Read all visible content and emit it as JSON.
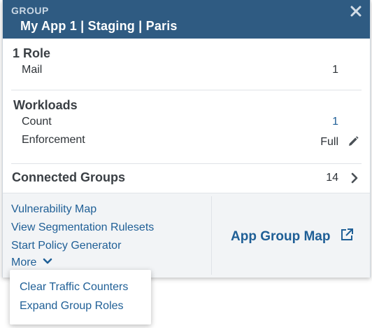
{
  "header": {
    "kicker": "GROUP",
    "title": "My App 1 | Staging | Paris",
    "close_icon": "close-icon"
  },
  "roles": {
    "title": "1 Role",
    "items": [
      {
        "label": "Mail",
        "value": "1"
      }
    ]
  },
  "workloads": {
    "title": "Workloads",
    "count_label": "Count",
    "count_value": "1",
    "enforcement_label": "Enforcement",
    "enforcement_value": "Full",
    "edit_icon": "pencil-icon"
  },
  "connected_groups": {
    "label": "Connected Groups",
    "value": "14",
    "chevron_icon": "chevron-right-icon"
  },
  "footer": {
    "links": [
      "Vulnerability Map",
      "View Segmentation Rulesets",
      "Start Policy Generator"
    ],
    "more_label": "More",
    "more_icon": "chevron-down-icon",
    "app_group_map_label": "App Group Map",
    "external_icon": "external-link-icon"
  },
  "more_menu": {
    "items": [
      "Clear Traffic Counters",
      "Expand Group Roles"
    ]
  },
  "colors": {
    "header_bg": "#2f5b82",
    "link": "#1f5f96",
    "footer_bg": "#f2f4f6"
  }
}
